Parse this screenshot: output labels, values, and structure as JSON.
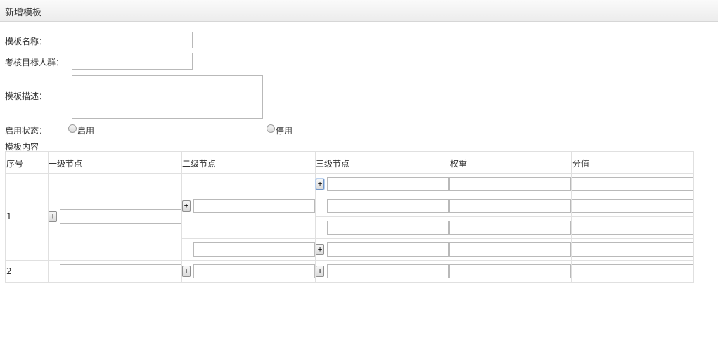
{
  "header": {
    "title": "新增模板"
  },
  "form": {
    "name_label": "模板名称：",
    "name_value": "",
    "target_label": "考核目标人群：",
    "target_value": "",
    "desc_label": "模板描述：",
    "desc_value": "",
    "status_label": "启用状态：",
    "status_options": [
      "启用",
      "停用"
    ],
    "content_label": "模板内容"
  },
  "table": {
    "columns": [
      "序号",
      "一级节点",
      "二级节点",
      "三级节点",
      "权重",
      "分值"
    ],
    "rows": [
      {
        "index": "1"
      },
      {
        "index": "2"
      }
    ],
    "add_button_label": "+"
  }
}
